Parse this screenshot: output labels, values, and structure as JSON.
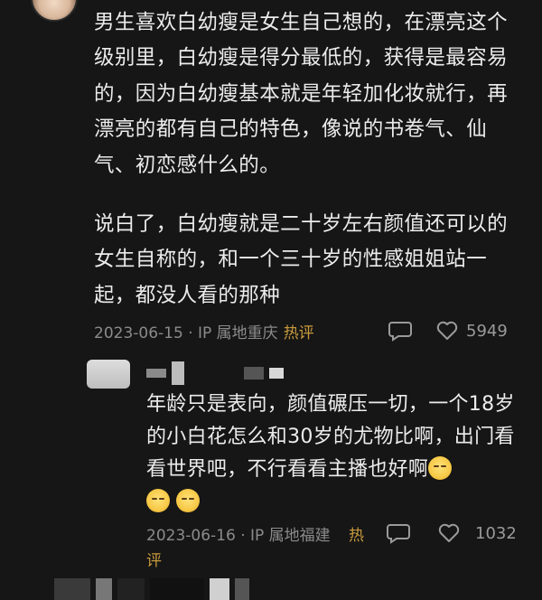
{
  "comment": {
    "para1": "男生喜欢白幼瘦是女生自己想的，在漂亮这个级别里，白幼瘦是得分最低的，获得是最容易的，因为白幼瘦基本就是年轻加化妆就行，再漂亮的都有自己的特色，像说的书卷气、仙气、初恋感什么的。",
    "para2": "说白了，白幼瘦就是二十岁左右颜值还可以的女生自称的，和一个三十岁的性感姐姐站一起，都没人看的那种",
    "date_location": "2023-06-15 · IP 属地重庆",
    "hot_tag": "热评",
    "comment_icon": "speech-bubble-icon",
    "like_icon": "heart-outline-icon",
    "likes": "5949"
  },
  "reply": {
    "text": "年龄只是表向，颜值碾压一切，一个18岁的小白花怎么和30岁的尤物比啊，出门看看世界吧，不行看看主播也好啊",
    "emoji_icon": "smirk-face-emoji",
    "date_location": "2023-06-16 · IP 属地福建",
    "hot_tag_line1": "热",
    "hot_tag_line2": "评",
    "comment_icon": "speech-bubble-icon",
    "like_icon": "heart-outline-icon",
    "likes": "1032"
  },
  "colors": {
    "background": "#161616",
    "text": "#ececec",
    "meta": "#8b8b8b",
    "hot": "#c89a3c"
  }
}
